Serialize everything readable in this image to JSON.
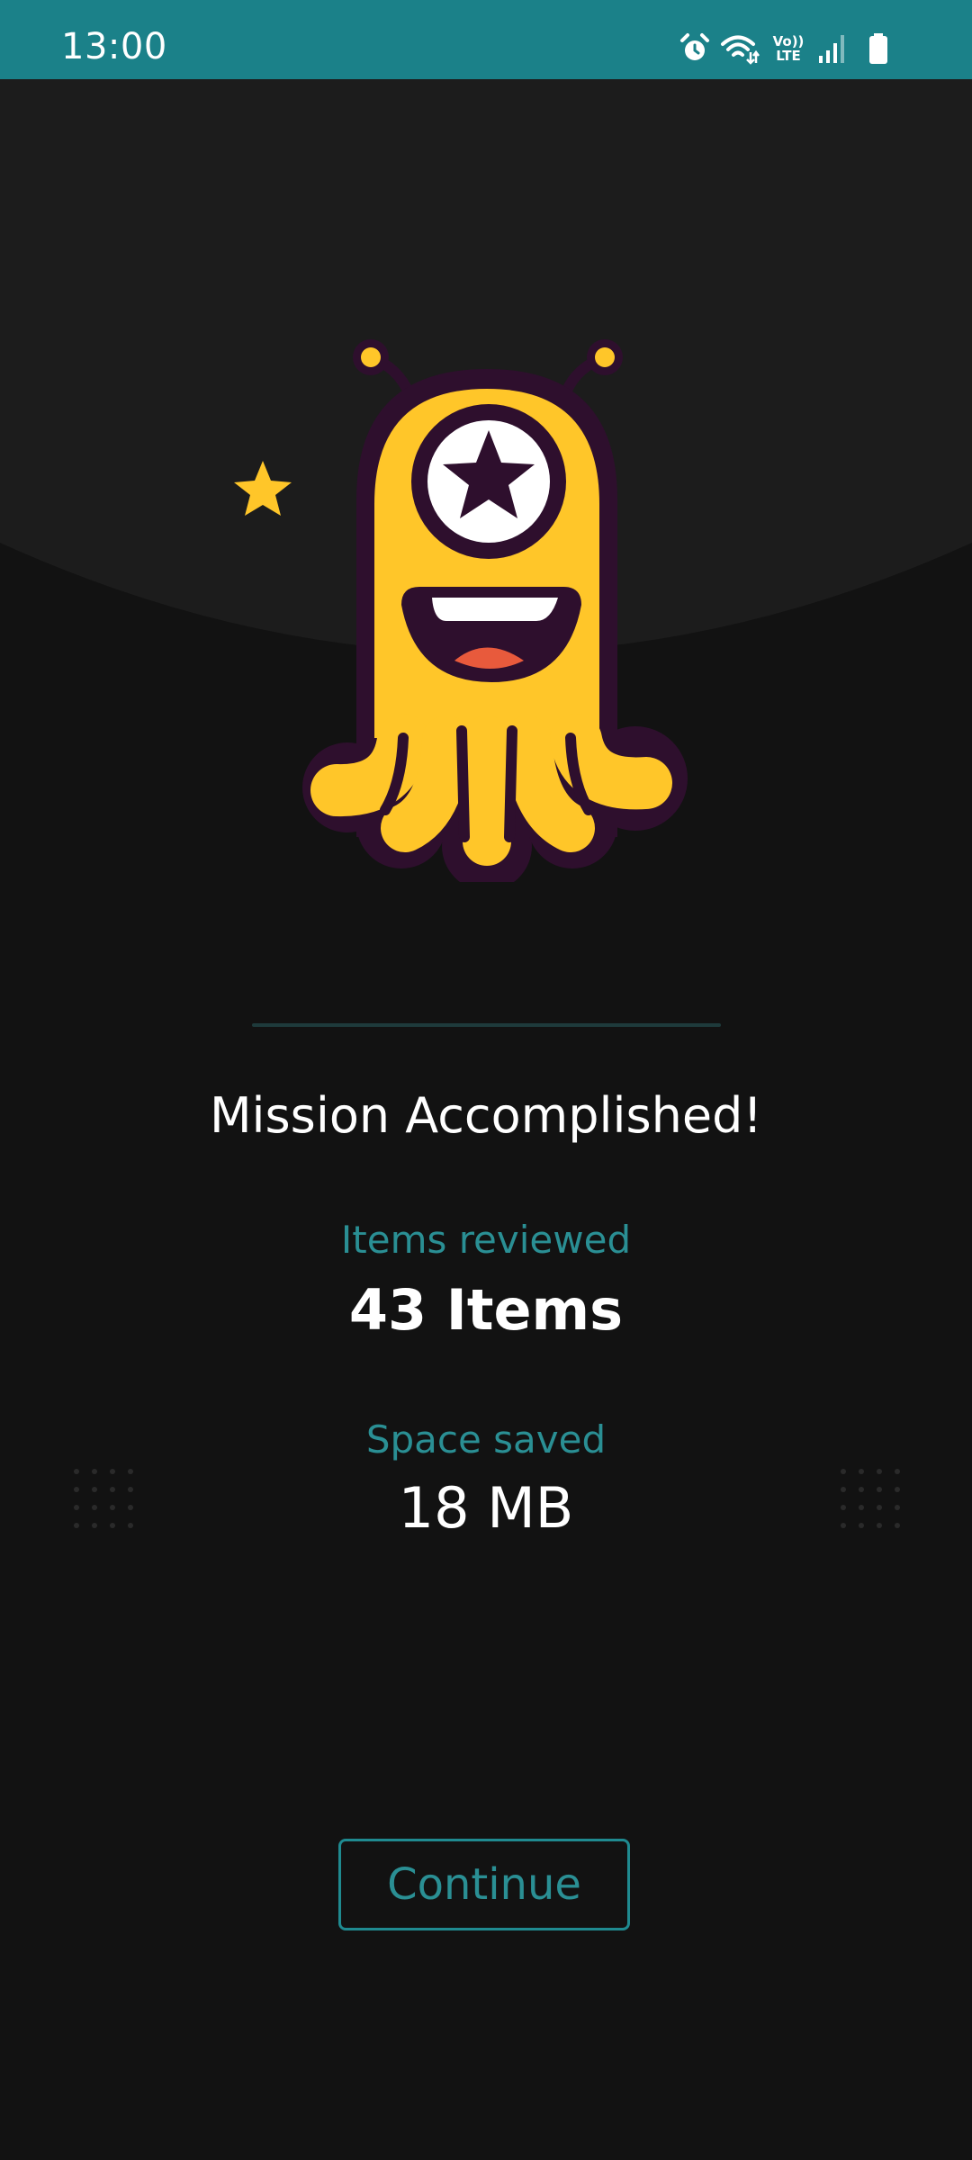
{
  "status_bar": {
    "time": "13:00",
    "network_label_top": "Vo))",
    "network_label_bottom": "LTE",
    "icons": [
      "alarm-icon",
      "wifi-icon",
      "volte-icon",
      "signal-icon",
      "battery-icon"
    ]
  },
  "result": {
    "title": "Mission Accomplished!",
    "items_label": "Items reviewed",
    "items_value": "43 Items",
    "space_label": "Space saved",
    "space_value": "18 MB"
  },
  "actions": {
    "continue_label": "Continue"
  },
  "colors": {
    "status_bar": "#1b8189",
    "background": "#121212",
    "accent_teal": "#2a8f94",
    "mascot_yellow": "#ffc629",
    "mascot_outline": "#2e0f2d",
    "mouth_tongue": "#e85a3c"
  }
}
